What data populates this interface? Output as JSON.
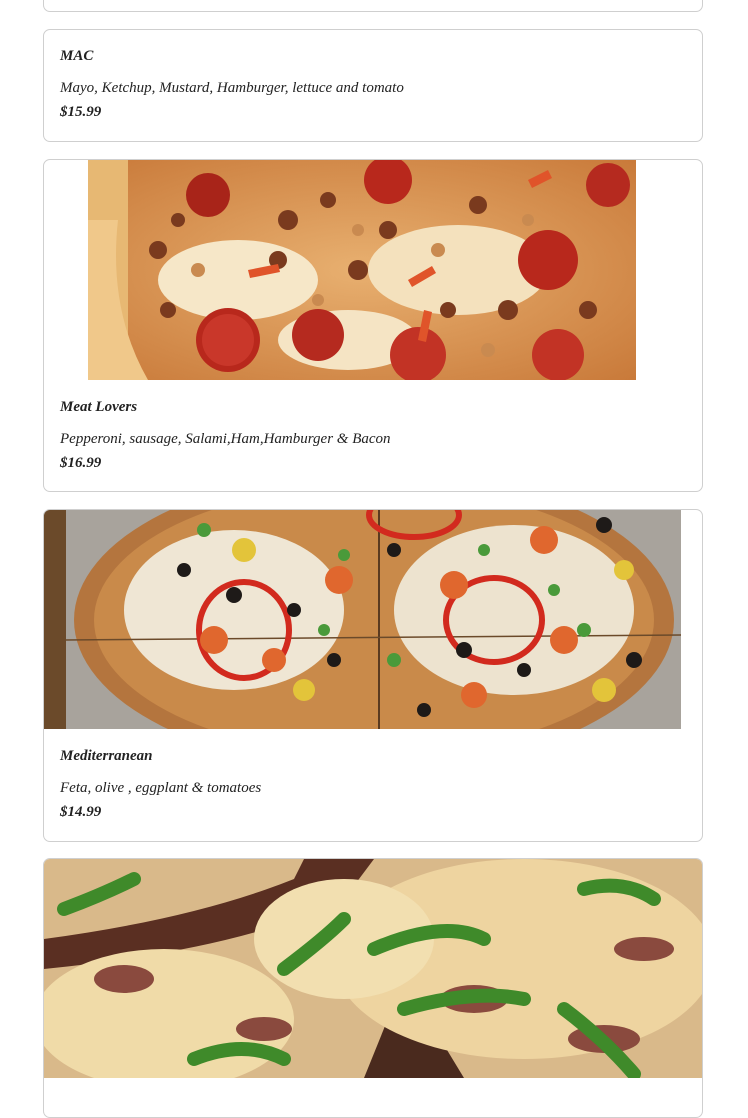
{
  "menu": {
    "items": [
      {
        "name": "MAC",
        "description": "Mayo, Ketchup, Mustard, Hamburger, lettuce and tomato",
        "price": "$15.99"
      },
      {
        "name": "Meat Lovers",
        "description": "Pepperoni, sausage, Salami,Ham,Hamburger & Bacon",
        "price": "$16.99"
      },
      {
        "name": "Mediterranean",
        "description": "Feta, olive , eggplant & tomatoes",
        "price": "$14.99"
      }
    ]
  }
}
